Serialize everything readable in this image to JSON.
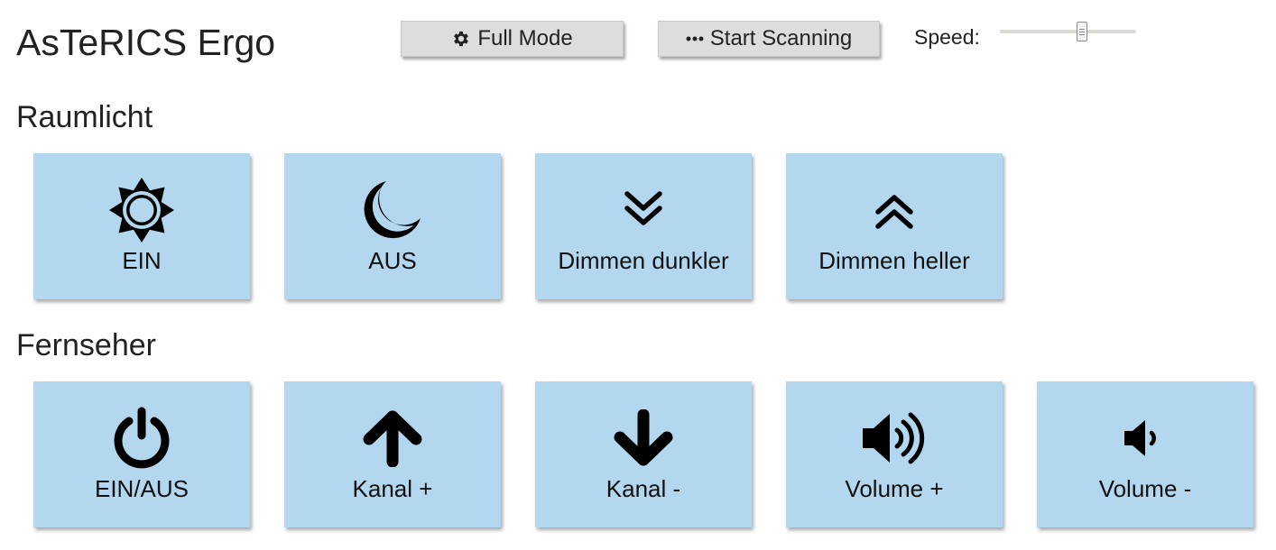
{
  "app": {
    "title": "AsTeRICS Ergo"
  },
  "toolbar": {
    "full_mode_label": "Full Mode",
    "full_mode_icon": "gear-icon",
    "start_scanning_label": "Start Scanning",
    "start_scanning_icon": "ellipsis-icon",
    "speed_label": "Speed:",
    "speed_level": 0.6
  },
  "sections": [
    {
      "title": "Raumlicht",
      "tiles": [
        {
          "label": "EIN",
          "icon": "sun-icon"
        },
        {
          "label": "AUS",
          "icon": "moon-icon"
        },
        {
          "label": "Dimmen dunkler",
          "icon": "double-chevron-down-icon"
        },
        {
          "label": "Dimmen heller",
          "icon": "double-chevron-up-icon"
        }
      ]
    },
    {
      "title": "Fernseher",
      "tiles": [
        {
          "label": "EIN/AUS",
          "icon": "power-icon"
        },
        {
          "label": "Kanal +",
          "icon": "arrow-up-icon"
        },
        {
          "label": "Kanal -",
          "icon": "arrow-down-icon"
        },
        {
          "label": "Volume +",
          "icon": "volume-up-icon"
        },
        {
          "label": "Volume -",
          "icon": "volume-down-icon"
        }
      ]
    }
  ],
  "colors": {
    "tile_background": "#b3d7ee",
    "button_background": "#dddddd",
    "text": "#222222"
  }
}
